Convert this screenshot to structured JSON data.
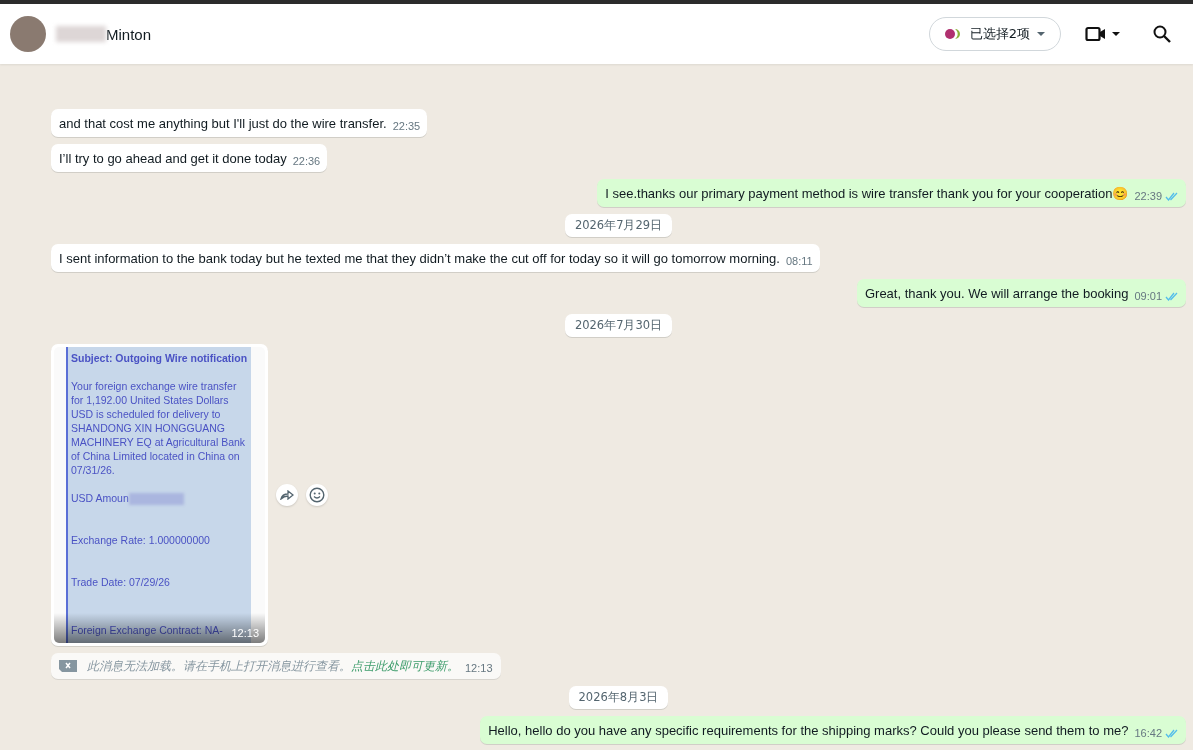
{
  "header": {
    "contact_name": "Minton",
    "selection_pill": {
      "label": "已选择2项"
    }
  },
  "messages": [
    {
      "kind": "text",
      "outgoing": false,
      "text": "and that cost me anything but I'll just do the wire transfer.",
      "time": "22:35"
    },
    {
      "kind": "text",
      "outgoing": false,
      "text": "I’ll try to go ahead and get it done today",
      "time": "22:36"
    },
    {
      "kind": "text",
      "outgoing": true,
      "text": "I see.thanks our primary payment method is wire transfer thank you for your cooperation😊",
      "time": "22:39",
      "read": true
    },
    {
      "kind": "date",
      "text": "2026年7月29日"
    },
    {
      "kind": "text",
      "outgoing": false,
      "text": "I sent information to the bank today but he texted me that they didn’t make the cut off for today so it will go tomorrow morning.",
      "time": "08:11"
    },
    {
      "kind": "text",
      "outgoing": true,
      "text": "Great, thank you. We will arrange the booking",
      "time": "09:01",
      "read": true
    },
    {
      "kind": "date",
      "text": "2026年7月30日"
    },
    {
      "kind": "image",
      "outgoing": false,
      "time": "12:13",
      "document": {
        "subject": "Subject: Outgoing Wire notification",
        "body": "Your foreign exchange wire transfer for 1,192.00 United States Dollars USD is scheduled for delivery to SHANDONG XIN HONGGUANG MACHINERY EQ at Agricultural Bank of China Limited located in China on 07/31/26.",
        "amount_label": "USD Amoun",
        "rate": "Exchange Rate: 1.000000000",
        "trade_date": "Trade Date: 07/29/26",
        "contract": "Foreign Exchange Contract: NA-"
      }
    },
    {
      "kind": "unsupported",
      "outgoing": false,
      "text": "此消息无法加载。请在手机上打开消息进行查看。",
      "link": "点击此处即可更新。",
      "time": "12:13"
    },
    {
      "kind": "date",
      "text": "2026年8月3日"
    },
    {
      "kind": "text",
      "outgoing": true,
      "text": "Hello, hello do you have any specific requirements for the shipping marks? Could you please send them to me?",
      "time": "16:42",
      "read": true
    }
  ]
}
